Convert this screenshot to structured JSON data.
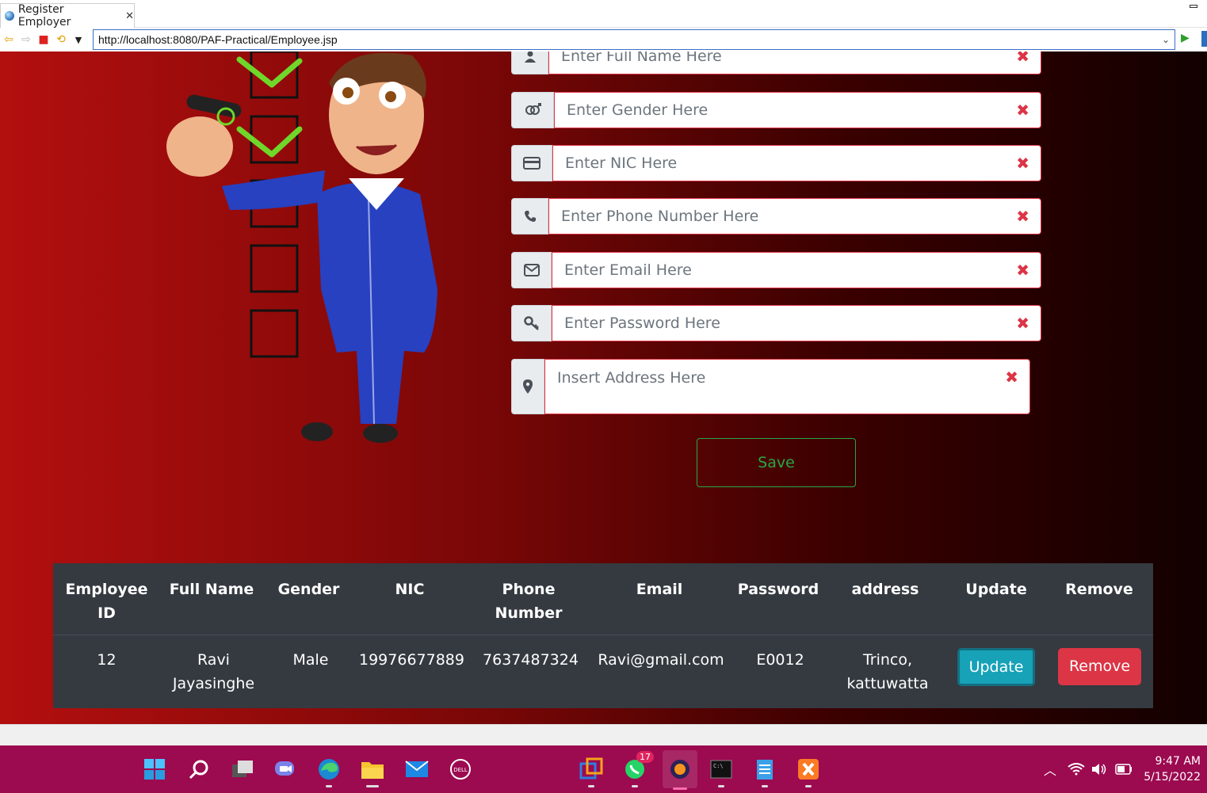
{
  "browser": {
    "tab_title": "Register Employer",
    "url": "http://localhost:8080/PAF-Practical/Employee.jsp"
  },
  "form": {
    "full_name_placeholder": "Enter Full Name Here",
    "gender_placeholder": "Enter Gender Here",
    "nic_placeholder": "Enter NIC Here",
    "phone_placeholder": "Enter Phone Number Here",
    "email_placeholder": "Enter Email Here",
    "password_placeholder": "Enter Password Here",
    "address_placeholder": "Insert Address Here",
    "clear_glyph": "✖",
    "save_label": "Save",
    "accent_error": "#dc3545",
    "accent_success": "#28a745"
  },
  "table": {
    "headers": [
      "Employee ID",
      "Full Name",
      "Gender",
      "NIC",
      "Phone Number",
      "Email",
      "Password",
      "address",
      "Update",
      "Remove"
    ],
    "rows": [
      {
        "id": "12",
        "full_name": "Ravi Jayasinghe",
        "gender": "Male",
        "nic": "19976677889",
        "phone": "7637487324",
        "email": "Ravi@gmail.com",
        "password": "E0012",
        "address": "Trinco, kattuwatta",
        "update_label": "Update",
        "remove_label": "Remove"
      }
    ]
  },
  "taskbar": {
    "whatsapp_badge": "17",
    "time": "9:47 AM",
    "date": "5/15/2022"
  }
}
